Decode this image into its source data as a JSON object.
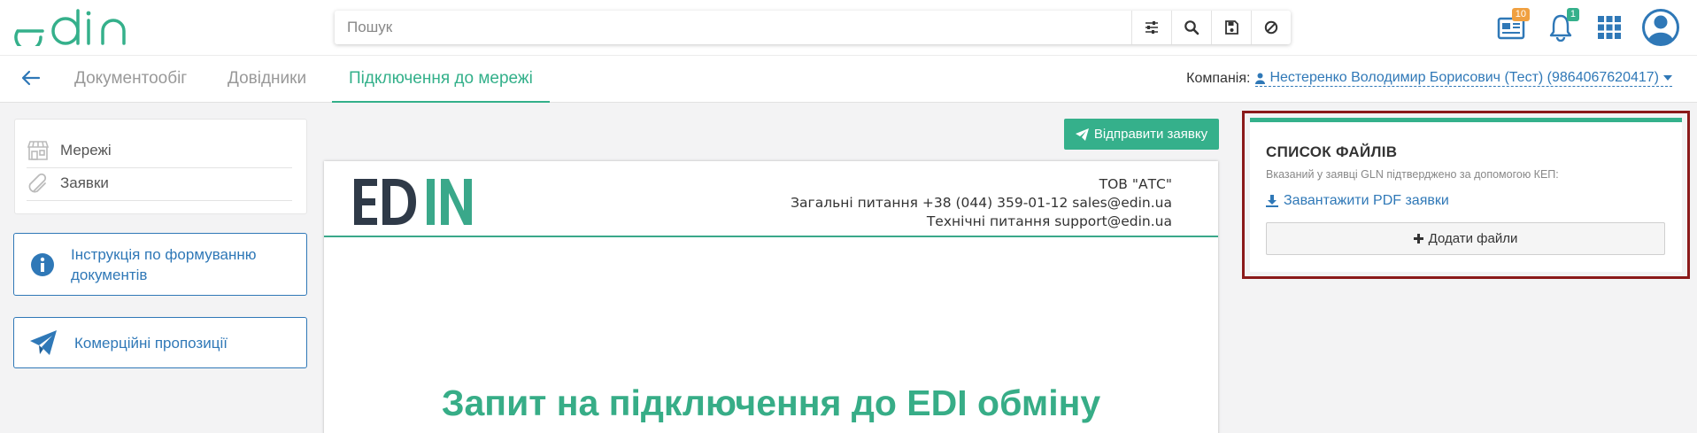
{
  "app": {
    "brand_color": "#34b18b",
    "link_color": "#2f78b7",
    "logo_text": "edin"
  },
  "search": {
    "placeholder": "Пошук",
    "value": ""
  },
  "header_actions": {
    "documents_badge": "10",
    "notifications_badge": "1",
    "icons": [
      "documents-icon",
      "bell-icon",
      "apps-grid-icon",
      "user-avatar-icon"
    ]
  },
  "nav": {
    "tabs": [
      {
        "label": "Документообіг"
      },
      {
        "label": "Довідники"
      },
      {
        "label": "Підключення до мережі",
        "active": true
      }
    ],
    "company_label": "Компанія:",
    "company_value": "Нестеренко Володимир Борисович (Тест) (9864067620417)"
  },
  "sidebar": {
    "items": [
      {
        "label": "Мережі",
        "icon": "store-icon"
      },
      {
        "label": "Заявки",
        "icon": "paperclip-icon"
      }
    ],
    "instruction_label": "Інструкція по формуванню документів",
    "offers_label": "Комерційні пропозиції"
  },
  "document": {
    "send_button": "Відправити заявку",
    "logo_text": "EDIN",
    "company": "ТОВ \"АТС\"",
    "general_contacts": "Загальні питання +38 (044) 359-01-12 sales@edin.ua",
    "tech_contacts": "Технічні питання support@edin.ua",
    "title": "Запит на підключення до EDI обміну"
  },
  "files_panel": {
    "title": "СПИСОК ФАЙЛІВ",
    "note": "Вказаний у заявці GLN підтверджено за допомогою КЕП:",
    "download_link": "Завантажити PDF заявки",
    "add_button": "Додати файли"
  }
}
